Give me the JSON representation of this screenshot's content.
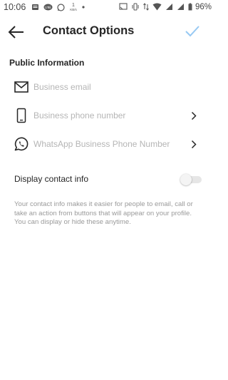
{
  "status_bar": {
    "time": "10:06",
    "network_speed_value": "1",
    "network_speed_unit": "KB/s",
    "battery": "96%"
  },
  "header": {
    "title": "Contact Options"
  },
  "section": {
    "title": "Public Information"
  },
  "fields": [
    {
      "label": "Business email",
      "icon": "mail-icon"
    },
    {
      "label": "Business phone number",
      "icon": "phone-icon"
    },
    {
      "label": "WhatsApp Business Phone Number",
      "icon": "whatsapp-icon"
    }
  ],
  "display_contact": {
    "label": "Display contact info",
    "enabled": false
  },
  "help_text": "Your contact info makes it easier for people to email, call or take an action from buttons that will appear on your profile. You can display or hide these anytime.",
  "colors": {
    "confirm_check": "#97c9f3",
    "placeholder_text": "#b5b5b5"
  }
}
